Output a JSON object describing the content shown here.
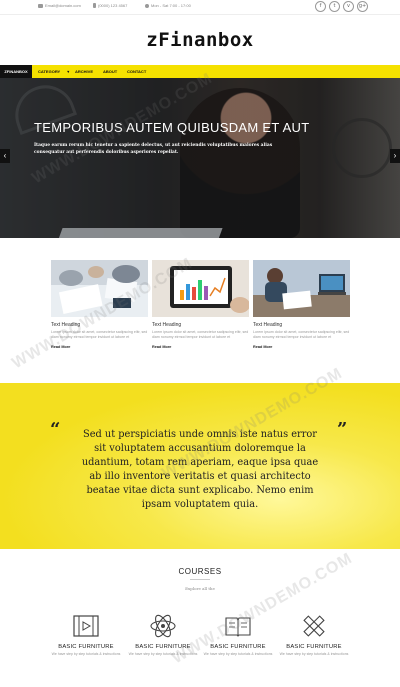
{
  "topbar": {
    "email": "Email@domain.com",
    "phone": "(0000) 123 4567",
    "hours": "Mon - Sat 7:00 - 17:00",
    "social_icons": [
      "facebook-icon",
      "twitter-icon",
      "vimeo-icon",
      "google-plus-icon"
    ]
  },
  "logo": {
    "prefix": "z",
    "name": "Finanbox"
  },
  "nav": {
    "brand": "ZFINANBOX",
    "items": [
      "CATEGORY",
      "ARCHIVE",
      "ABOUT",
      "CONTACT"
    ]
  },
  "hero": {
    "title": "TEMPORIBUS AUTEM QUIBUSDAM ET AUT",
    "text": "Itaque earum rerum hic tenetur a sapiente delectus, ut aut reiciendis voluptatibus maiores alias consequatur aut perferendis doloribus asperiores repellat.",
    "prev": "‹",
    "next": "›"
  },
  "cards": [
    {
      "heading": "Text Heading",
      "text": "Lorem ipsum dolor sit amet, consectetur sadipscing elitr, sed diam nonumy eirmod tempor invidunt ut labore et",
      "more": "Read More"
    },
    {
      "heading": "Text Heading",
      "text": "Lorem ipsum dolor sit amet, consectetur sadipscing elitr, sed diam nonumy eirmod tempor invidunt ut labore et",
      "more": "Read More"
    },
    {
      "heading": "Text Heading",
      "text": "Lorem ipsum dolor sit amet, consectetur sadipscing elitr, sed diam nonumy eirmod tempor invidunt ut labore et",
      "more": "Read More"
    }
  ],
  "quote": {
    "open": "“",
    "close": "”",
    "text": "Sed ut perspiciatis unde omnis iste natus error sit voluptatem accusantium doloremque la udantium, totam rem aperiam, eaque ipsa quae ab illo inventore veritatis et quasi architecto beatae vitae dicta sunt explicabo. Nemo enim ipsam voluptatem quia."
  },
  "courses": {
    "title": "COURSES",
    "subtitle": "Explore all the",
    "items": [
      {
        "title": "BASIC FURNITURE",
        "text": "We have step by step tutorials & instructions",
        "icon": "film-icon"
      },
      {
        "title": "BASIC FURNITURE",
        "text": "We have step by step tutorials & instructions",
        "icon": "atom-icon"
      },
      {
        "title": "BASIC FURNITURE",
        "text": "We have step by step tutorials & instructions",
        "icon": "book-icon"
      },
      {
        "title": "BASIC FURNITURE",
        "text": "We have step by step tutorials & instructions",
        "icon": "pencil-ruler-icon"
      }
    ]
  },
  "watermark": "WWW.DOWNDEMO.COM",
  "colors": {
    "accent": "#f5e100",
    "dark": "#111111"
  }
}
